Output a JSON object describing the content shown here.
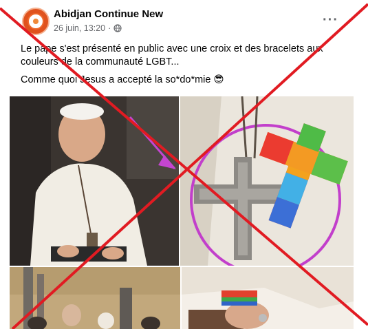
{
  "post": {
    "page_name": "Abidjan Continue New",
    "timestamp": "26 juin, 13:20",
    "separator": "·",
    "privacy_icon": "globe-icon",
    "more_label": "···",
    "text_line1": "Le pape s'est présenté en public avec une croix et des bracelets aux couleurs de la communauté LGBT...",
    "text_line2": "Comme quoi Jesus a accepté la so*do*mie 😎"
  },
  "overlay": {
    "x_color": "#e11b22"
  }
}
